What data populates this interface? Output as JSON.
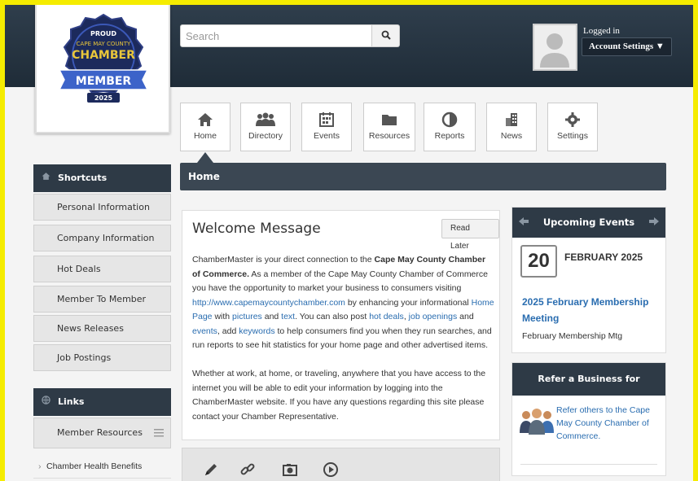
{
  "header": {
    "search_placeholder": "Search",
    "search_icon": "search-icon",
    "logged_in": "Logged in",
    "account_settings": "Account Settings ▼"
  },
  "logo": {
    "line1": "PROUD",
    "line2": "CAPE MAY COUNTY",
    "line3": "CHAMBER",
    "line4": "MEMBER",
    "line5": "2025"
  },
  "nav": [
    {
      "label": "Home",
      "icon": "home-icon"
    },
    {
      "label": "Directory",
      "icon": "people-icon"
    },
    {
      "label": "Events",
      "icon": "calendar-icon"
    },
    {
      "label": "Resources",
      "icon": "folder-icon"
    },
    {
      "label": "Reports",
      "icon": "pie-icon"
    },
    {
      "label": "News",
      "icon": "building-icon"
    },
    {
      "label": "Settings",
      "icon": "gear-icon"
    }
  ],
  "breadcrumb": "Home",
  "sidebar": {
    "shortcuts_title": "Shortcuts",
    "items": [
      "Personal Information",
      "Company Information",
      "Hot Deals",
      "Member To Member Deals",
      "News Releases",
      "Job Postings"
    ],
    "links_title": "Links",
    "member_resources": "Member Resources",
    "sublink": "Chamber Health Benefits"
  },
  "welcome": {
    "title": "Welcome Message",
    "read_later": "Read Later",
    "p1_a": "ChamberMaster is your direct connection to the ",
    "p1_b": "Cape May County Chamber of Commerce.",
    "p1_c": " As a member of the Cape May County Chamber of Commerce you have the opportunity to market your business to consumers visiting ",
    "p1_link": "http://www.capemaycountychamber.com",
    "p1_d": " by enhancing your informational ",
    "p1_homepage": "Home Page",
    "p1_e": " with ",
    "p1_pictures": "pictures",
    "p1_f": " and ",
    "p1_text": "text",
    "p1_g": ". You can also post ",
    "p1_hotdeals": "hot deals",
    "p1_h": ", ",
    "p1_jobs": "job openings",
    "p1_i": " and ",
    "p1_events": "events",
    "p1_j": ", add ",
    "p1_keywords": "keywords",
    "p1_k": " to help consumers find you when they run searches, and run reports to see hit statistics for your home page and other advertised items.",
    "p2": "Whether at work, at home, or traveling, anywhere that you have access to the internet you will be able to edit your information by logging into the ChamberMaster website. If you have any questions regarding this site please contact your Chamber Representative."
  },
  "upcoming": {
    "title": "Upcoming Events",
    "day": "20",
    "month": "FEBRUARY 2025",
    "event_title": "2025 February Membership Meeting",
    "event_sub": "February Membership Mtg"
  },
  "refer": {
    "title": "Refer a Business for Membership",
    "text": "Refer others to the Cape May County Chamber of Commerce."
  },
  "colors": {
    "frame": "#f5ec00",
    "header_dark": "#2e3a46",
    "link_blue": "#2a6db0"
  }
}
